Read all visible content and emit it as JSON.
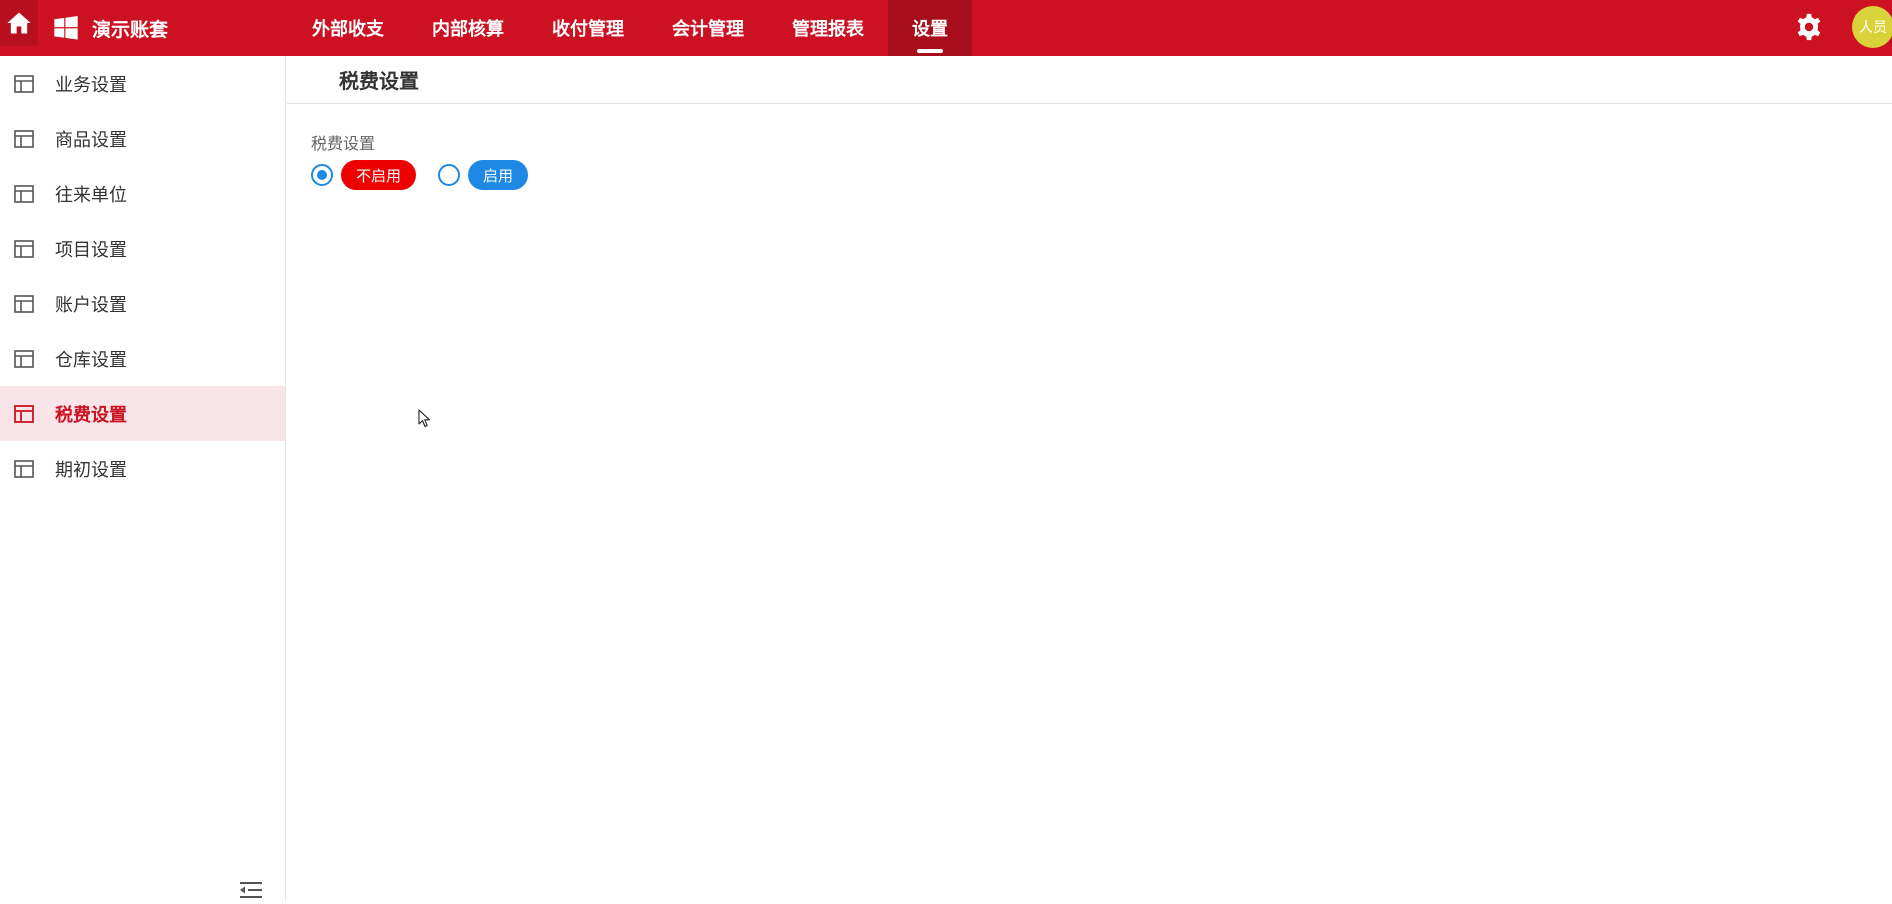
{
  "header": {
    "brand": "演示账套",
    "nav": [
      "外部收支",
      "内部核算",
      "收付管理",
      "会计管理",
      "管理报表",
      "设置"
    ],
    "active_nav": "设置",
    "avatar_text": "人员"
  },
  "sidebar": {
    "items": [
      {
        "label": "业务设置",
        "active": false
      },
      {
        "label": "商品设置",
        "active": false
      },
      {
        "label": "往来单位",
        "active": false
      },
      {
        "label": "项目设置",
        "active": false
      },
      {
        "label": "账户设置",
        "active": false
      },
      {
        "label": "仓库设置",
        "active": false
      },
      {
        "label": "税费设置",
        "active": true
      },
      {
        "label": "期初设置",
        "active": false
      }
    ]
  },
  "main": {
    "title": "税费设置",
    "field_label": "税费设置",
    "options": [
      {
        "label": "不启用",
        "checked": true
      },
      {
        "label": "启用",
        "checked": false
      }
    ]
  },
  "colors": {
    "brand_red": "#cc1122",
    "active_nav_bg": "#a80d1b",
    "sidebar_active_bg": "#f9e5e7",
    "radio_blue": "#1e88e5",
    "pill_red": "#ee0000",
    "avatar_bg": "#d9d23a"
  }
}
